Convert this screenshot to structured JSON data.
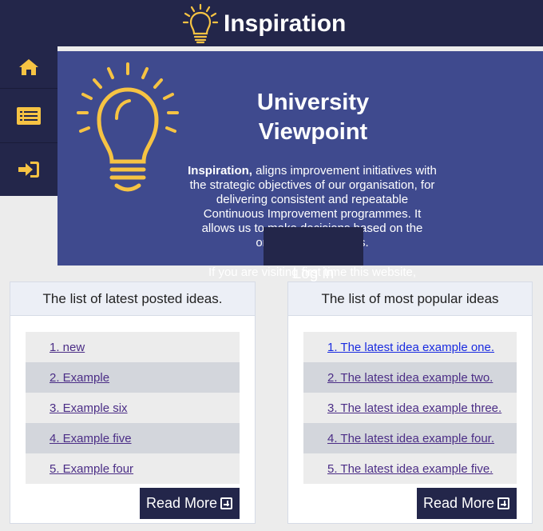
{
  "header": {
    "title": "Inspiration",
    "logo_icon": "lightbulb-icon"
  },
  "sidebar": {
    "items": [
      {
        "icon": "home-icon"
      },
      {
        "icon": "list-icon"
      },
      {
        "icon": "sign-in-icon"
      }
    ]
  },
  "hero": {
    "title": "University Viewpoint",
    "intro_bold": "Inspiration,",
    "intro_text": " aligns improvement initiatives with the strategic objectives of our organisation, for delivering consistent and repeatable Continuous Improvement programmes. It allows us to make decisions based on the organisation's needs.",
    "visiting_text": "If you are visiting first time this website,",
    "here_link": "here",
    "login_label": "Log in"
  },
  "latest": {
    "heading": "The list of latest posted ideas.",
    "items": [
      "1. new",
      "2. Example",
      "3. Example six",
      "4. Example five",
      "5. Example four"
    ],
    "read_more": "Read More"
  },
  "popular": {
    "heading": "The list of most popular ideas",
    "items": [
      "1. The latest idea example one.",
      "2. The latest idea example two.",
      "3. The latest idea example three.",
      "4. The latest idea example four.",
      "5. The latest idea example five."
    ],
    "read_more": "Read More"
  },
  "colors": {
    "navy": "#23264a",
    "hero_blue": "#3f4a8e",
    "accent_yellow": "#f6c343",
    "link_purple": "#4b2d86"
  }
}
